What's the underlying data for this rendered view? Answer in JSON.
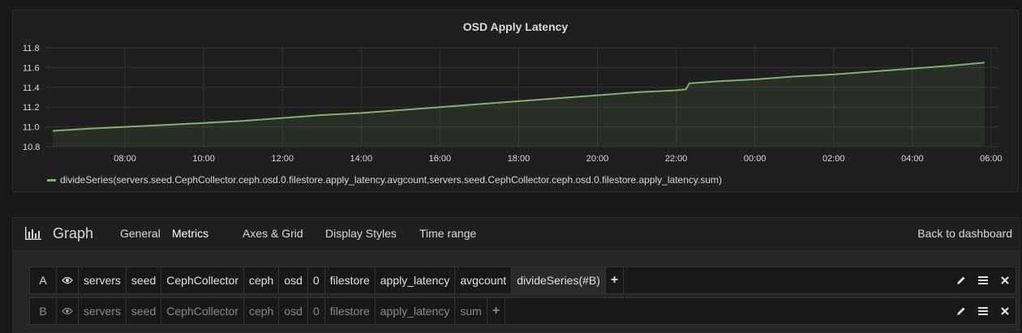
{
  "panel": {
    "title": "OSD Apply Latency",
    "legend": "divideSeries(servers.seed.CephCollector.ceph.osd.0.filestore.apply_latency.avgcount,servers.seed.CephCollector.ceph.osd.0.filestore.apply_latency.sum)",
    "series_color": "#7eb26d"
  },
  "chart_data": {
    "type": "line",
    "title": "OSD Apply Latency",
    "xlabel": "",
    "ylabel": "",
    "y_ticks": [
      "10.8",
      "11.0",
      "11.2",
      "11.4",
      "11.6",
      "11.8"
    ],
    "ylim": [
      10.8,
      11.8
    ],
    "x_ticks": [
      "08:00",
      "10:00",
      "12:00",
      "14:00",
      "16:00",
      "18:00",
      "20:00",
      "22:00",
      "00:00",
      "02:00",
      "04:00",
      "06:00"
    ],
    "grid": true,
    "legend_position": "bottom-left",
    "series": [
      {
        "name": "divideSeries(servers.seed.CephCollector.ceph.osd.0.filestore.apply_latency.avgcount,servers.seed.CephCollector.ceph.osd.0.filestore.apply_latency.sum)",
        "x": [
          "06:10",
          "07:00",
          "08:00",
          "09:00",
          "10:00",
          "11:00",
          "12:00",
          "13:00",
          "14:00",
          "15:00",
          "16:00",
          "17:00",
          "18:00",
          "19:00",
          "20:00",
          "21:00",
          "22:00",
          "22:15",
          "22:20",
          "23:00",
          "00:00",
          "01:00",
          "02:00",
          "03:00",
          "04:00",
          "05:00",
          "05:50"
        ],
        "values": [
          10.96,
          10.98,
          11.0,
          11.02,
          11.04,
          11.06,
          11.09,
          11.12,
          11.14,
          11.17,
          11.2,
          11.23,
          11.26,
          11.29,
          11.32,
          11.35,
          11.37,
          11.38,
          11.44,
          11.46,
          11.48,
          11.51,
          11.53,
          11.56,
          11.59,
          11.62,
          11.65
        ]
      }
    ]
  },
  "editor": {
    "title": "Graph",
    "tabs": [
      "General",
      "Metrics",
      "Axes & Grid",
      "Display Styles",
      "Time range"
    ],
    "active_tab": "Metrics",
    "back_label": "Back to dashboard",
    "targets": [
      {
        "letter": "A",
        "segments": [
          "servers",
          "seed",
          "CephCollector",
          "ceph",
          "osd",
          "0",
          "filestore",
          "apply_latency",
          "avgcount"
        ],
        "function": "divideSeries(#B)"
      },
      {
        "letter": "B",
        "segments": [
          "servers",
          "seed",
          "CephCollector",
          "ceph",
          "osd",
          "0",
          "filestore",
          "apply_latency",
          "sum"
        ],
        "function": ""
      }
    ],
    "icons": [
      "eye-icon",
      "plus-icon",
      "pencil-icon",
      "menu-icon",
      "close-icon"
    ]
  }
}
